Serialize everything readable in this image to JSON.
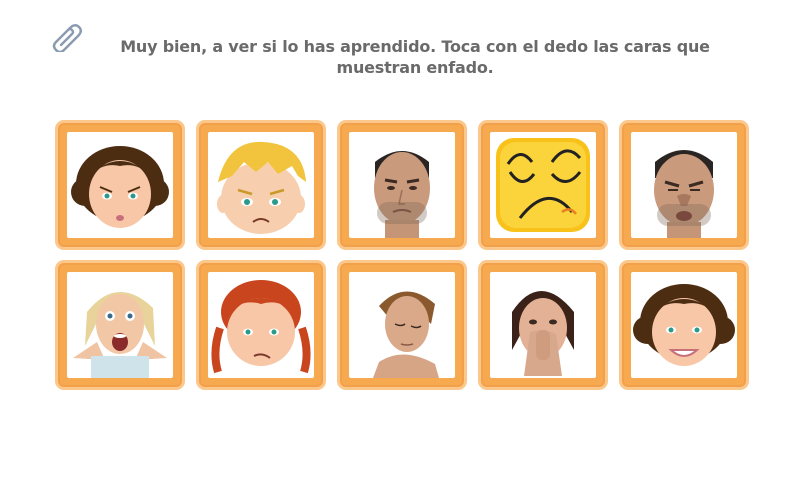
{
  "instruction": {
    "text": "Muy bien, a ver si lo has aprendido. Toca con el dedo las caras que muestran enfado."
  },
  "icons": {
    "attachment": "paperclip-icon"
  },
  "cards": [
    {
      "face": "cartoon-girl-brown-hair-angry"
    },
    {
      "face": "cartoon-boy-blond-hair-angry"
    },
    {
      "face": "photo-man-frowning"
    },
    {
      "face": "emoji-angry-yellow-square"
    },
    {
      "face": "photo-man-grimacing"
    },
    {
      "face": "photo-woman-surprised"
    },
    {
      "face": "cartoon-girl-red-braids-sad"
    },
    {
      "face": "photo-young-man-looking-down"
    },
    {
      "face": "photo-woman-holding-nose"
    },
    {
      "face": "cartoon-girl-brown-hair-smiling"
    }
  ],
  "colors": {
    "card_fill": "#f7a950",
    "card_border": "#fbc78b",
    "text": "#6a6a6a"
  }
}
